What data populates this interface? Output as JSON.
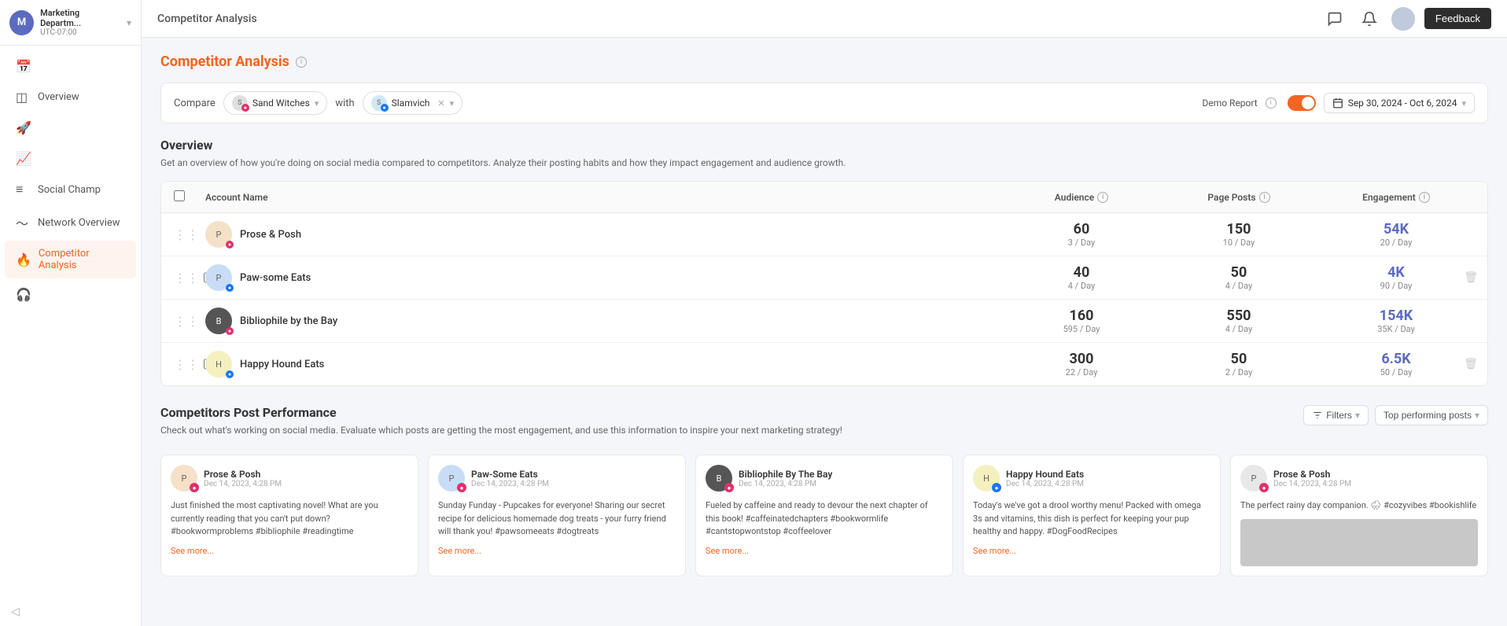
{
  "sidebar": {
    "org": "Marketing Departm...",
    "tz": "UTC-07:00",
    "avatar_initial": "M",
    "items": [
      {
        "id": "calendar",
        "label": "Calendar",
        "icon": "📅",
        "active": false
      },
      {
        "id": "overview",
        "label": "Overview",
        "icon": "📊",
        "active": false
      },
      {
        "id": "publish",
        "label": "Publish",
        "icon": "🚀",
        "active": false
      },
      {
        "id": "analytics",
        "label": "Analytics",
        "icon": "📈",
        "active": false
      },
      {
        "id": "social-champ",
        "label": "Social Champ",
        "icon": "≡",
        "active": false
      },
      {
        "id": "network-overview",
        "label": "Network Overview",
        "icon": "~",
        "active": false
      },
      {
        "id": "competitor-analysis",
        "label": "Competitor Analysis",
        "icon": "🔥",
        "active": true
      },
      {
        "id": "listening",
        "label": "Listening",
        "icon": "🎧",
        "active": false
      }
    ]
  },
  "topbar": {
    "breadcrumb": "Competitor Analysis",
    "feedback_label": "Feedback"
  },
  "page": {
    "title": "Competitor Analysis",
    "filter": {
      "compare_label": "Compare",
      "with_label": "with",
      "account1": "Sand Witches",
      "account2": "Slamvich",
      "demo_report_label": "Demo Report",
      "date_range": "Sep 30, 2024 - Oct 6, 2024"
    },
    "overview": {
      "title": "Overview",
      "desc": "Get an overview of how you're doing on social media compared to competitors. Analyze their posting habits and how they impact engagement and audience growth.",
      "table_headers": {
        "account": "Account Name",
        "audience": "Audience",
        "page_posts": "Page Posts",
        "engagement": "Engagement"
      },
      "rows": [
        {
          "name": "Prose & Posh",
          "audience_value": "60",
          "audience_sub": "3 / Day",
          "page_posts_value": "150",
          "page_posts_sub": "10 / Day",
          "engagement_value": "54K",
          "engagement_sub": "20 / Day",
          "has_delete": false
        },
        {
          "name": "Paw-some Eats",
          "audience_value": "40",
          "audience_sub": "4 / Day",
          "page_posts_value": "50",
          "page_posts_sub": "4 / Day",
          "engagement_value": "4K",
          "engagement_sub": "90 / Day",
          "has_delete": true
        },
        {
          "name": "Bibliophile by the Bay",
          "audience_value": "160",
          "audience_sub": "595 / Day",
          "page_posts_value": "550",
          "page_posts_sub": "4 / Day",
          "engagement_value": "154K",
          "engagement_sub": "35K / Day",
          "has_delete": false
        },
        {
          "name": "Happy Hound Eats",
          "audience_value": "300",
          "audience_sub": "22 / Day",
          "page_posts_value": "50",
          "page_posts_sub": "2 / Day",
          "engagement_value": "6.5K",
          "engagement_sub": "50 / Day",
          "has_delete": true
        }
      ]
    },
    "post_performance": {
      "title": "Competitors Post Performance",
      "desc": "Check out what's working on social media. Evaluate which posts are getting the most engagement, and use this information to inspire your next marketing strategy!",
      "filters_label": "Filters",
      "top_posts_label": "Top performing posts",
      "cards": [
        {
          "account": "Prose & Posh",
          "date": "Dec 14, 2023, 4:28 PM",
          "text": "Just finished the most captivating novel! What are you currently reading that you can't put down? #bookwormproblems #bibliophile #readingtime",
          "see_more": "See more..."
        },
        {
          "account": "Paw-Some Eats",
          "date": "Dec 14, 2023, 4:28 PM",
          "text": "Sunday Funday - Pupcakes for everyone! Sharing our secret recipe for delicious homemade dog treats - your furry friend will thank you! #pawsomeeats #dogtreats",
          "see_more": "See more..."
        },
        {
          "account": "Bibliophile By The Bay",
          "date": "Dec 14, 2023, 4:28 PM",
          "text": "Fueled by caffeine and ready to devour the next chapter of this book! #caffeinatedchapters #bookwormlife #cantstopwontstop #coffeelover",
          "see_more": "See more..."
        },
        {
          "account": "Happy Hound Eats",
          "date": "Dec 14, 2023, 4:28 PM",
          "text": "Today's we've got a drool worthy menu! Packed with omega 3s and vitamins, this dish is perfect for keeping your pup healthy and happy. #DogFoodRecipes",
          "see_more": "See more..."
        },
        {
          "account": "Prose & Posh",
          "date": "Dec 14, 2023, 4:28 PM",
          "text": "The perfect rainy day companion. 🌧 #cozyvibes #bookishlife",
          "see_more": ""
        }
      ]
    }
  }
}
